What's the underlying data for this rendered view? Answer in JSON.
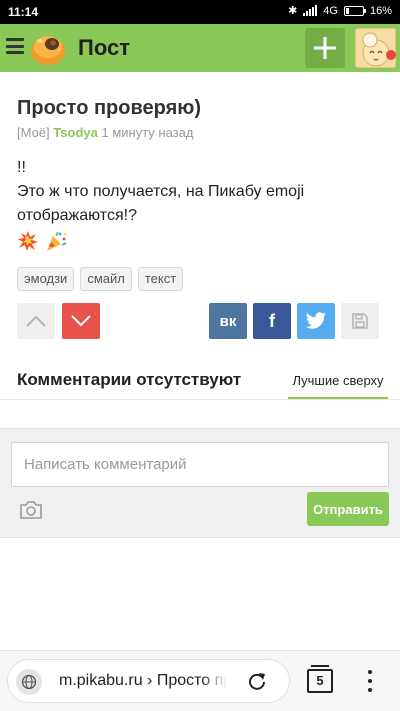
{
  "status_bar": {
    "time": "11:14",
    "network": "4G",
    "battery": "16%",
    "battery_level": 0.16
  },
  "header": {
    "title": "Пост",
    "menu_icon": "hamburger-icon",
    "logo_icon": "pikabu-logo",
    "add_icon": "plus-icon",
    "avatar_icon": "user-avatar"
  },
  "post": {
    "title": "Просто проверяю)",
    "meta_tag": "[Моё]",
    "author": "Tsodya",
    "time_ago": "1 минуту назад",
    "body_line1": "!!",
    "body_line2": "Это ж что получается, на Пикабу emoji отображаются!?",
    "emojis": [
      "💥",
      "🎉"
    ],
    "tags": [
      "эмодзи",
      "смайл",
      "текст"
    ],
    "share_vk": "вк",
    "share_fb": "f"
  },
  "comments": {
    "title": "Комментарии отсутствуют",
    "sort_label": "Лучшие сверху",
    "input_placeholder": "Написать комментарий",
    "send_label": "Отправить"
  },
  "browser": {
    "url": "m.pikabu.ru › Просто проверяю)",
    "tab_count": "5"
  },
  "colors": {
    "brand_green": "#8ac858",
    "downvote_red": "#e7524a",
    "vk": "#4d76a1",
    "facebook": "#3b5998",
    "twitter": "#55acee"
  }
}
